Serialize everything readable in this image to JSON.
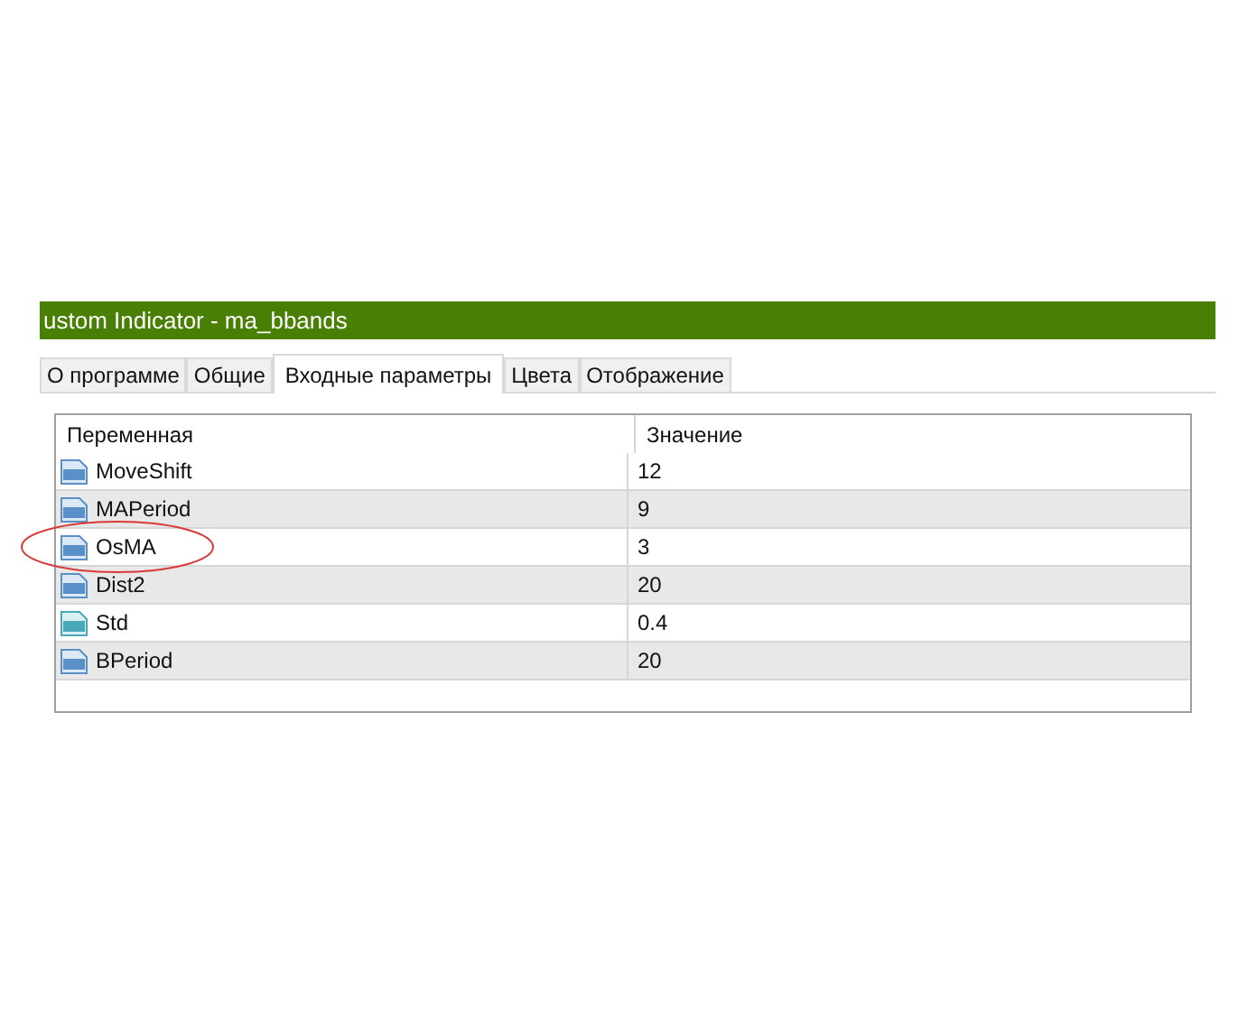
{
  "window": {
    "title": "ustom Indicator - ma_bbands"
  },
  "tabs": [
    {
      "label": "О программе",
      "selected": false
    },
    {
      "label": "Общие",
      "selected": false
    },
    {
      "label": "Входные параметры",
      "selected": true
    },
    {
      "label": "Цвета",
      "selected": false
    },
    {
      "label": "Отображение",
      "selected": false
    }
  ],
  "table": {
    "columns": [
      "Переменная",
      "Значение"
    ],
    "rows": [
      {
        "kind": "int",
        "name": "MoveShift",
        "value": "12",
        "circled": false
      },
      {
        "kind": "int",
        "name": "MAPeriod",
        "value": "9",
        "circled": false
      },
      {
        "kind": "int",
        "name": "OsMA",
        "value": "3",
        "circled": true
      },
      {
        "kind": "int",
        "name": "Dist2",
        "value": "20",
        "circled": false
      },
      {
        "kind": "double",
        "name": "Std",
        "value": "0.4",
        "circled": false
      },
      {
        "kind": "int",
        "name": "BPeriod",
        "value": "20",
        "circled": false
      }
    ]
  }
}
